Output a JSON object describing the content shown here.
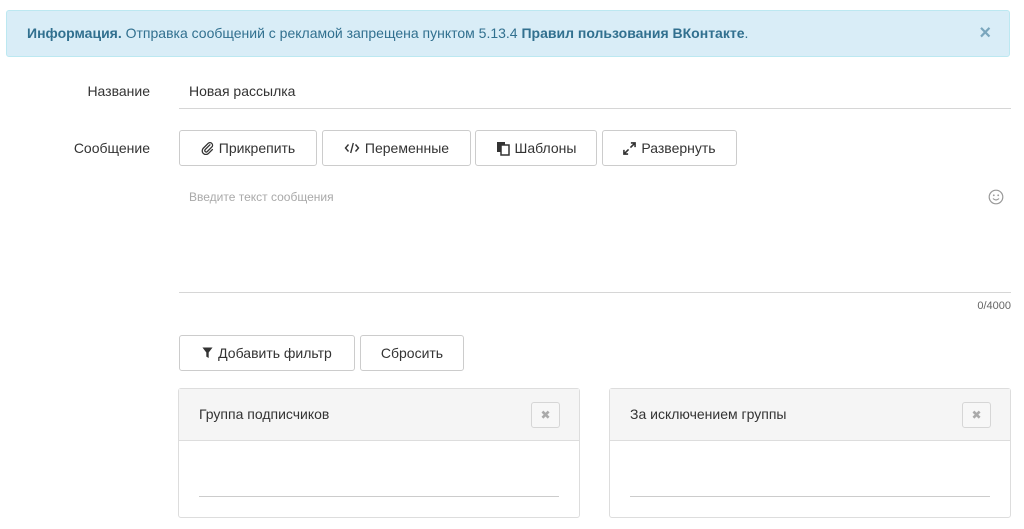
{
  "alert": {
    "prefix": "Информация.",
    "text": " Отправка сообщений с рекламой запрещена пунктом 5.13.4 ",
    "link": "Правил пользования ВКонтакте",
    "suffix": ".",
    "close": "×"
  },
  "form": {
    "name_label": "Название",
    "name_value": "Новая рассылка",
    "message_label": "Сообщение",
    "message_placeholder": "Введите текст сообщения",
    "counter": "0/4000"
  },
  "toolbar": {
    "attach": "Прикрепить",
    "variables": "Переменные",
    "templates": "Шаблоны",
    "expand": "Развернуть"
  },
  "filters": {
    "add": "Добавить фильтр",
    "reset": "Сбросить"
  },
  "panels": [
    {
      "title": "Группа подписчиков",
      "close": "✖"
    },
    {
      "title": "За исключением группы",
      "close": "✖"
    }
  ],
  "colors": {
    "alert_bg": "#d9edf7",
    "alert_text": "#31708f"
  },
  "icons": {
    "attach": "paperclip-icon",
    "variables": "code-icon",
    "templates": "copy-icon",
    "expand": "expand-icon",
    "filter": "filter-icon",
    "emoji": "smile-icon"
  }
}
